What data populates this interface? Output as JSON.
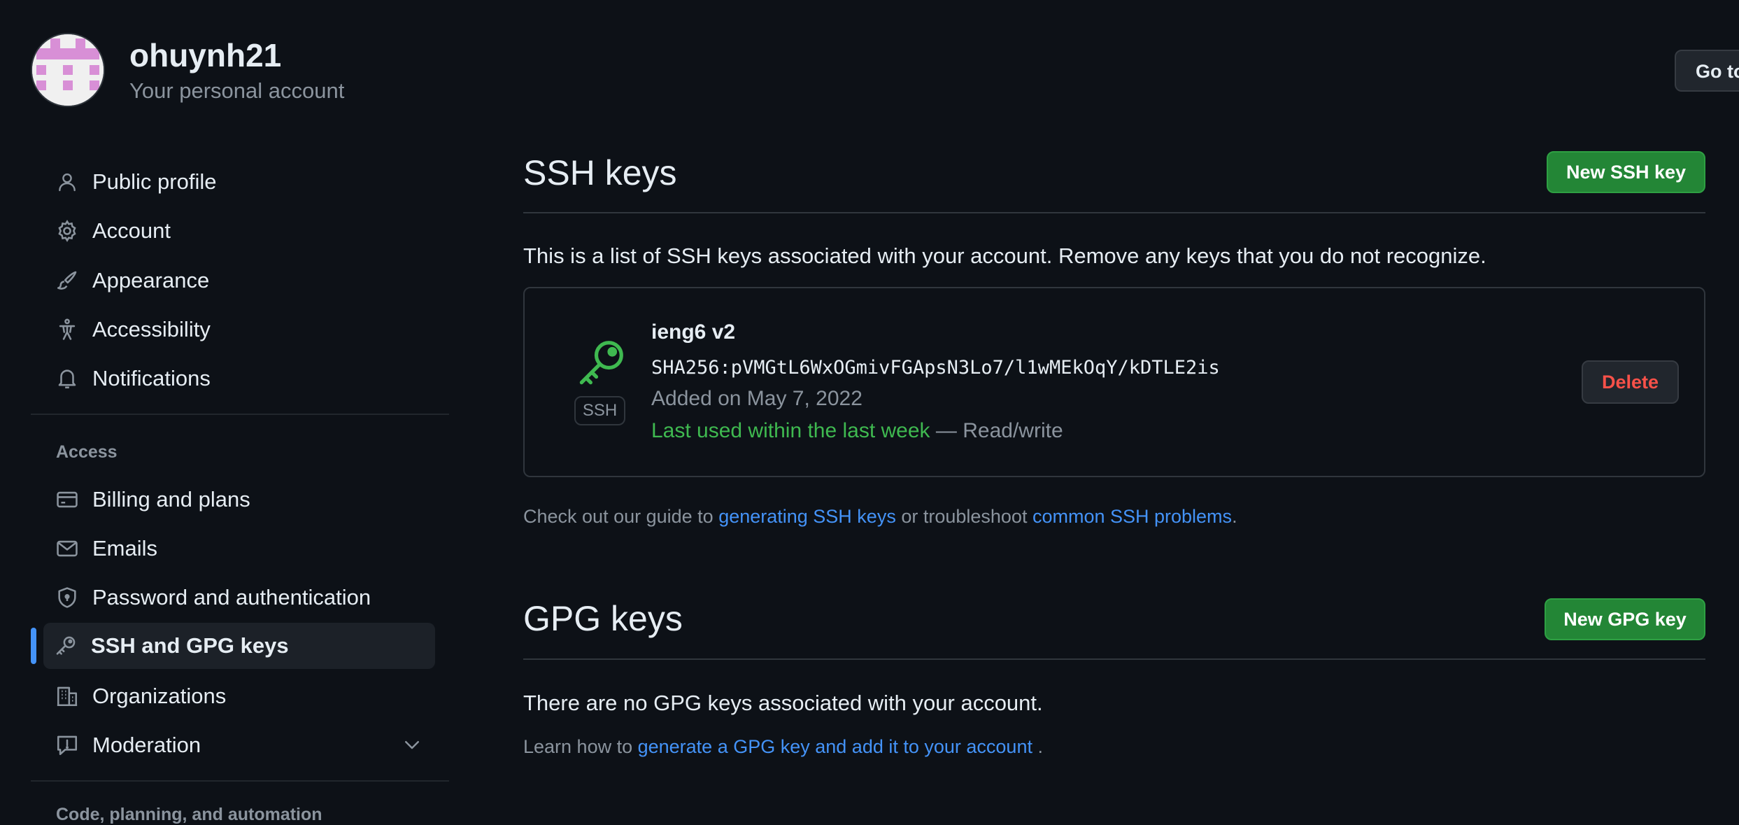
{
  "header": {
    "username": "ohuynh21",
    "subtitle": "Your personal account",
    "goto_button": "Go to"
  },
  "sidebar": {
    "items": [
      {
        "label": "Public profile",
        "icon": "person-icon"
      },
      {
        "label": "Account",
        "icon": "gear-icon"
      },
      {
        "label": "Appearance",
        "icon": "paintbrush-icon"
      },
      {
        "label": "Accessibility",
        "icon": "accessibility-icon"
      },
      {
        "label": "Notifications",
        "icon": "bell-icon"
      }
    ],
    "access_heading": "Access",
    "access_items": [
      {
        "label": "Billing and plans",
        "icon": "credit-card-icon"
      },
      {
        "label": "Emails",
        "icon": "mail-icon"
      },
      {
        "label": "Password and authentication",
        "icon": "shield-icon"
      },
      {
        "label": "SSH and GPG keys",
        "icon": "key-icon",
        "active": true
      },
      {
        "label": "Organizations",
        "icon": "organization-icon"
      },
      {
        "label": "Moderation",
        "icon": "report-icon"
      }
    ],
    "code_heading": "Code, planning, and automation"
  },
  "ssh": {
    "title": "SSH keys",
    "new_button": "New SSH key",
    "description": "This is a list of SSH keys associated with your account. Remove any keys that you do not recognize.",
    "key": {
      "badge": "SSH",
      "name": "ieng6 v2",
      "fingerprint": "SHA256:pVMGtL6WxOGmivFGApsN3Lo7/l1wMEkOqY/kDTLE2is",
      "added": "Added on May 7, 2022",
      "last_used": "Last used within the last week",
      "access": " — Read/write",
      "delete_button": "Delete"
    },
    "help_prefix": "Check out our guide to ",
    "help_link1": "generating SSH keys",
    "help_middle": " or troubleshoot ",
    "help_link2": "common SSH problems",
    "help_suffix": "."
  },
  "gpg": {
    "title": "GPG keys",
    "new_button": "New GPG key",
    "empty_text": "There are no GPG keys associated with your account.",
    "help_prefix": "Learn how to ",
    "help_link": "generate a GPG key and add it to your account",
    "help_suffix": " ."
  },
  "colors": {
    "background": "#0d1117",
    "accent_blue": "#4493f8",
    "green_button": "#238636",
    "green_text": "#3fb950",
    "danger": "#f85149",
    "avatar_pink": "#d88fd6"
  }
}
